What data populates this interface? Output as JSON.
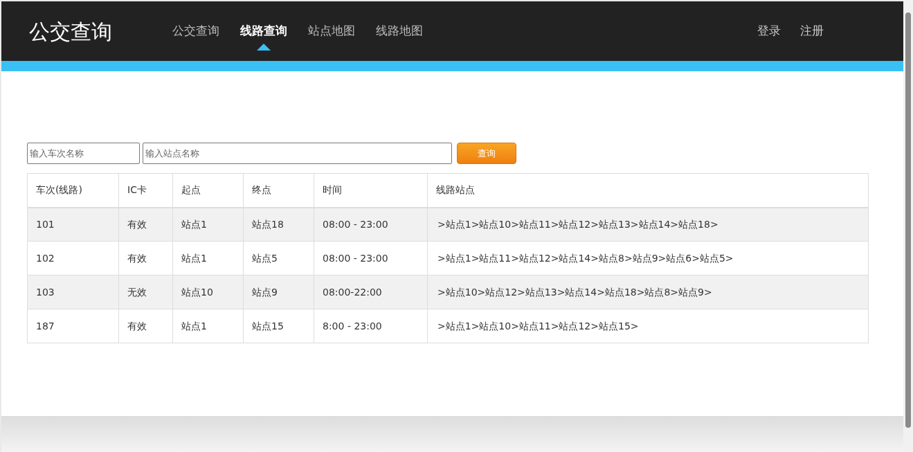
{
  "header": {
    "logo": "公交查询",
    "nav": [
      {
        "label": "公交查询",
        "selected": false
      },
      {
        "label": "线路查询",
        "selected": true
      },
      {
        "label": "站点地图",
        "selected": false
      },
      {
        "label": "线路地图",
        "selected": false
      }
    ],
    "account": [
      "登录",
      "注册"
    ]
  },
  "search": {
    "fields": [
      {
        "placeholder": "输入车次名称"
      },
      {
        "placeholder": "输入站点名称"
      }
    ],
    "button": "查询"
  },
  "table": {
    "columns": [
      "车次(线路)",
      "IC卡",
      "起点",
      "终点",
      "时间",
      "线路站点"
    ],
    "rows": [
      [
        "101",
        "有效",
        "站点1",
        "站点18",
        "08:00 - 23:00",
        ">站点1>站点10>站点11>站点12>站点13>站点14>站点18>"
      ],
      [
        "102",
        "有效",
        "站点1",
        "站点5",
        "08:00 - 23:00",
        ">站点1>站点11>站点12>站点14>站点8>站点9>站点6>站点5>"
      ],
      [
        "103",
        "无效",
        "站点10",
        "站点9",
        "08:00-22:00",
        ">站点10>站点12>站点13>站点14>站点18>站点8>站点9>"
      ],
      [
        "187",
        "有效",
        "站点1",
        "站点15",
        "8:00 - 23:00",
        ">站点1>站点10>站点11>站点12>站点15>"
      ]
    ]
  }
}
